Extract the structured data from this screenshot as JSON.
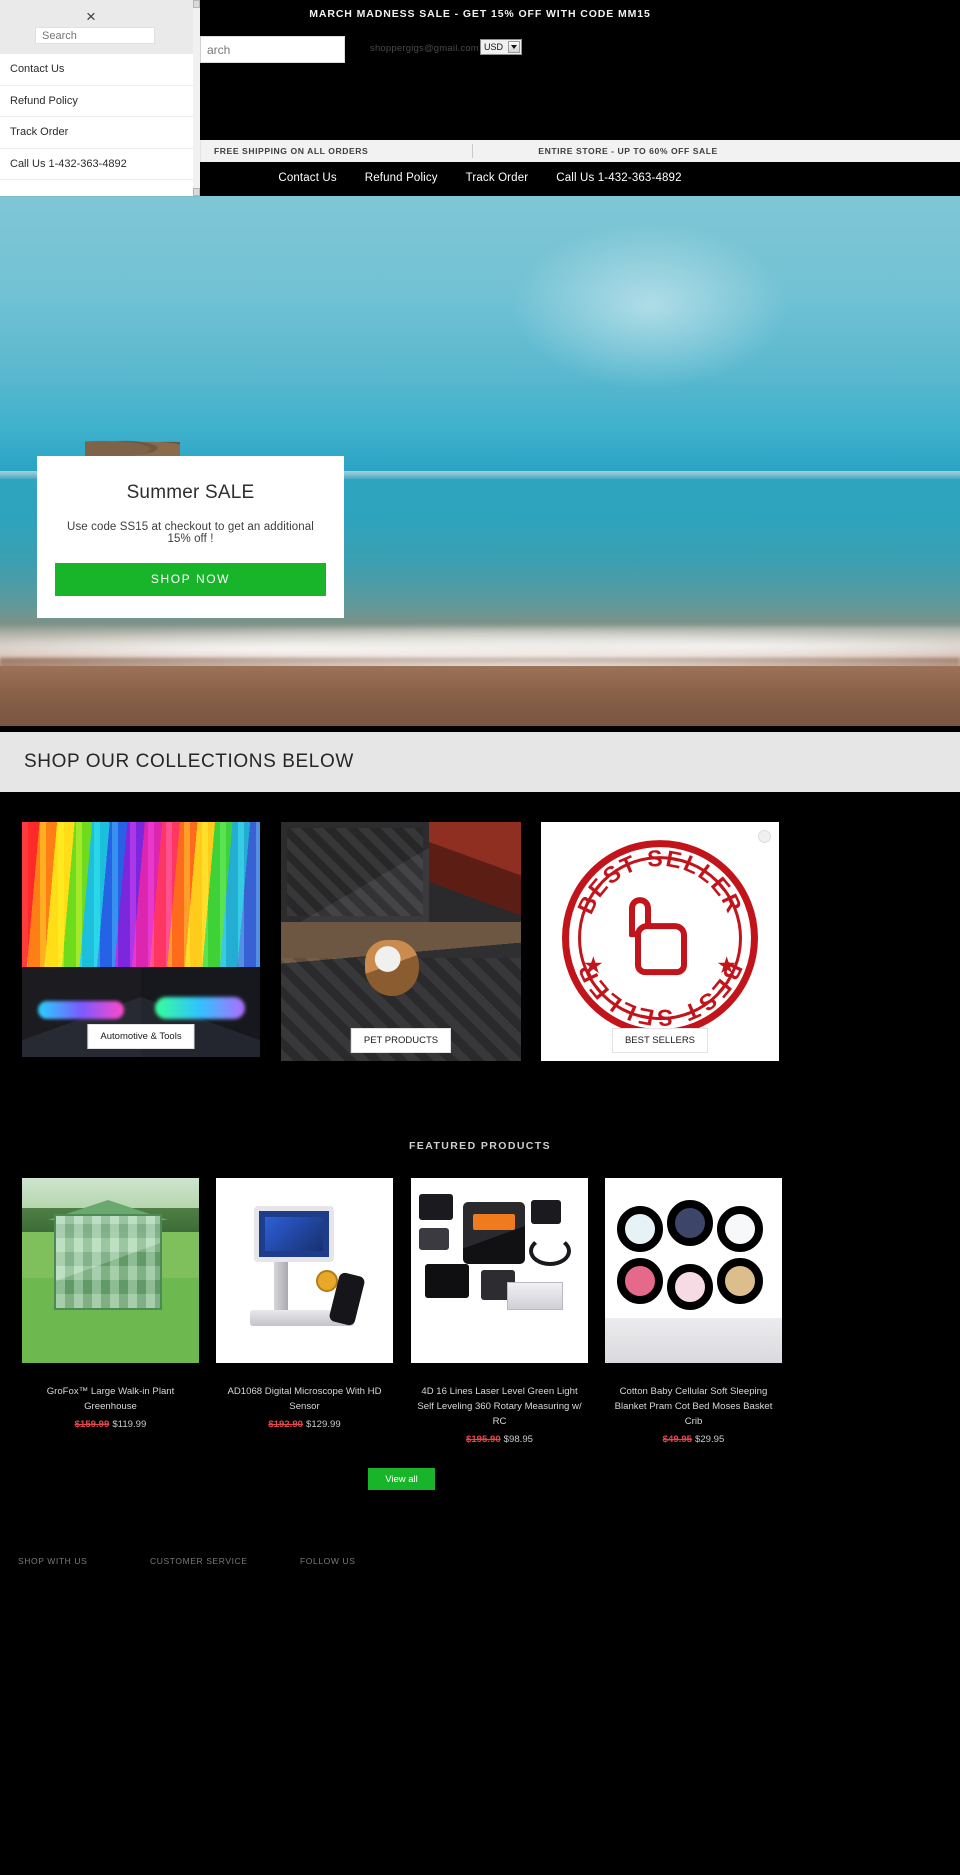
{
  "announcement": {
    "text": "MARCH MADNESS SALE - GET 15% OFF WITH CODE MM15"
  },
  "header": {
    "search_placeholder": "Search",
    "search_value": "arch",
    "account_email": "shoppergigs@gmail.com",
    "currency_selected": "USD",
    "cart_glyph": "0"
  },
  "promo_bar": {
    "left": "FREE SHIPPING ON ALL ORDERS",
    "right": "ENTIRE STORE - UP TO 60% OFF SALE"
  },
  "main_nav": {
    "items": [
      {
        "label": "Contact Us"
      },
      {
        "label": "Refund Policy"
      },
      {
        "label": "Track Order"
      },
      {
        "label": "Call Us 1-432-363-4892"
      }
    ]
  },
  "drawer": {
    "close_icon": "×",
    "search_placeholder": "Search",
    "items": [
      {
        "label": "Contact Us"
      },
      {
        "label": "Refund Policy"
      },
      {
        "label": "Track Order"
      },
      {
        "label": "Call Us 1-432-363-4892"
      }
    ]
  },
  "hero": {
    "title": "Summer SALE",
    "subtitle": "Use code SS15 at checkout to get an additional 15% off !",
    "cta": "SHOP NOW"
  },
  "collections_section": {
    "heading": "SHOP OUR COLLECTIONS BELOW",
    "tiles": [
      {
        "label": "Automotive & Tools"
      },
      {
        "label": "PET PRODUCTS"
      },
      {
        "label": "BEST SELLERS"
      }
    ]
  },
  "best_seller_stamp": {
    "top_text": "BEST SELLER",
    "bottom_text": "BEST SELLER"
  },
  "featured": {
    "heading": "FEATURED PRODUCTS",
    "view_all": "View all",
    "products": [
      {
        "name": "GroFox™ Large Walk-in Plant Greenhouse",
        "was": "$159.99",
        "now": "$119.99"
      },
      {
        "name": "AD1068 Digital Microscope With HD Sensor",
        "was": "$192.90",
        "now": "$129.99"
      },
      {
        "name": "4D 16 Lines Laser Level Green Light Self Leveling 360 Rotary Measuring w/ RC",
        "was": "$195.90",
        "now": "$98.95"
      },
      {
        "name": "Cotton Baby Cellular Soft Sleeping Blanket Pram Cot Bed Moses Basket Crib",
        "was": "$49.95",
        "now": "$29.95"
      }
    ]
  },
  "footer_peek": {
    "col1": "SHOP WITH US",
    "col2": "CUSTOMER SERVICE",
    "col3": "FOLLOW US"
  },
  "colors": {
    "accent_green": "#18b52b",
    "sale_red": "#e2454c",
    "stamp_red": "#c2141b",
    "bar_black": "#000000",
    "band_grey": "#e6e6e6"
  }
}
